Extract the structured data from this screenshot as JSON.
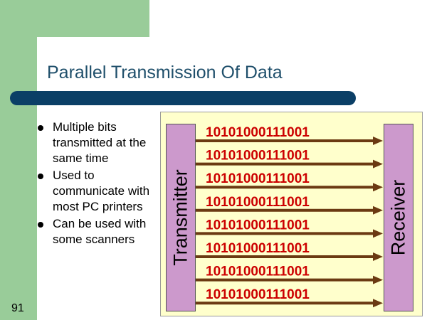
{
  "slide": {
    "title": "Parallel Transmission Of Data",
    "page_number": "91",
    "bullets": [
      "Multiple bits transmitted at the same time",
      "Used to communicate with most PC printers",
      "Can be used with some scanners"
    ]
  },
  "diagram": {
    "sender_label": "Transmitter",
    "receiver_label": "Receiver",
    "bit_streams": [
      "10101000111001",
      "10101000111001",
      "10101000111001",
      "10101000111001",
      "10101000111001",
      "10101000111001",
      "10101000111001",
      "10101000111001"
    ],
    "colors": {
      "background_band": "#99CC99",
      "title_text": "#1F4F6B",
      "title_bar": "#0B3F66",
      "panel": "#FFFFCC",
      "device_boxes": "#CC99CC",
      "bits": "#CC0000",
      "arrows": "#6B3A12"
    }
  }
}
